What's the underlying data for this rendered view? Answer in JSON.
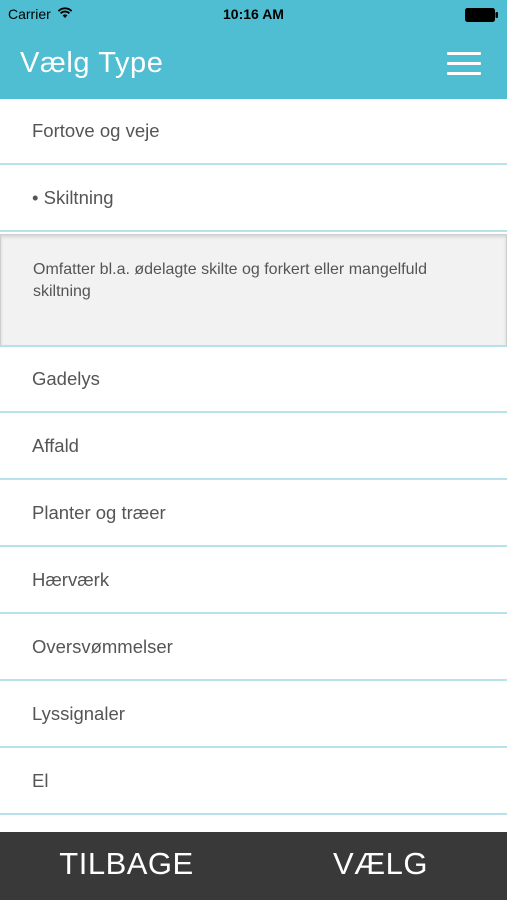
{
  "status_bar": {
    "carrier": "Carrier",
    "time": "10:16 AM",
    "wifi_icon": "wifi-icon",
    "battery_icon": "battery-icon"
  },
  "header": {
    "title": "Vælg Type",
    "menu_icon": "hamburger-menu-icon",
    "accent_color": "#4fbdd2"
  },
  "list": {
    "items": [
      {
        "label": "Fortove og veje"
      },
      {
        "label": "• Skiltning",
        "expanded": true
      },
      {
        "label": "Gadelys"
      },
      {
        "label": "Affald"
      },
      {
        "label": "Planter og træer"
      },
      {
        "label": "Hærværk"
      },
      {
        "label": "Oversvømmelser"
      },
      {
        "label": "Lyssignaler"
      },
      {
        "label": "El"
      }
    ],
    "description": "Omfatter bl.a. ødelagte skilte og forkert eller mangelfuld skiltning"
  },
  "footer": {
    "back_label": "TILBAGE",
    "choose_label": "VÆLG",
    "background_color": "#393939"
  }
}
